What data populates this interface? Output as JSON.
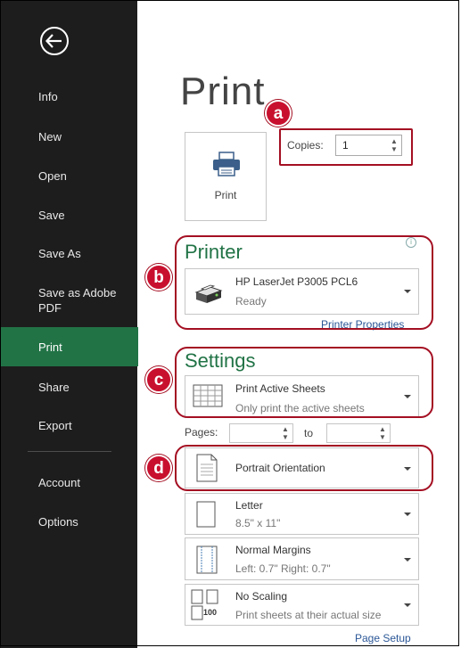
{
  "sidebar": {
    "items": [
      {
        "label": "Info"
      },
      {
        "label": "New"
      },
      {
        "label": "Open"
      },
      {
        "label": "Save"
      },
      {
        "label": "Save As"
      },
      {
        "label": "Save as Adobe\nPDF"
      },
      {
        "label": "Print"
      },
      {
        "label": "Share"
      },
      {
        "label": "Export"
      },
      {
        "label": "Account"
      },
      {
        "label": "Options"
      }
    ],
    "active": "Print"
  },
  "main": {
    "title": "Print",
    "print_button_label": "Print",
    "copies_label": "Copies:",
    "copies_value": "1",
    "printer_section": "Printer",
    "printer_name": "HP LaserJet P3005 PCL6",
    "printer_status": "Ready",
    "printer_properties": "Printer Properties",
    "settings_section": "Settings",
    "settings_items": [
      {
        "primary": "Print Active Sheets",
        "secondary": "Only print the active sheets"
      },
      {
        "primary": "Portrait Orientation",
        "secondary": ""
      },
      {
        "primary": "Letter",
        "secondary": "8.5\" x 11\""
      },
      {
        "primary": "Normal Margins",
        "secondary": "Left: 0.7\"   Right: 0.7\""
      },
      {
        "primary": "No Scaling",
        "secondary": "Print sheets at their actual size"
      }
    ],
    "pages_label": "Pages:",
    "to_label": "to",
    "page_setup": "Page Setup",
    "scaling_icon_text": "100"
  },
  "callouts": [
    "a",
    "b",
    "c",
    "d"
  ],
  "colors": {
    "accent": "#217346",
    "callout": "#c8102e",
    "sidebar": "#1d1d1d",
    "link": "#2b5797"
  }
}
